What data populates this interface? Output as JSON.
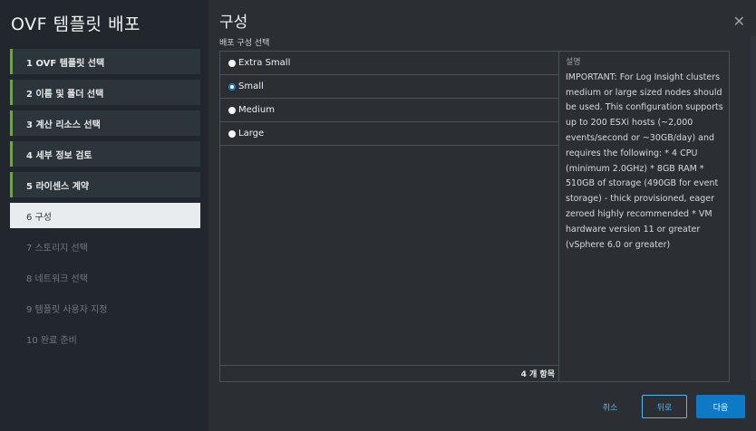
{
  "wizard": {
    "title": "OVF 템플릿 배포"
  },
  "steps": [
    {
      "label": "1 OVF 템플릿 선택",
      "state": "done"
    },
    {
      "label": "2 이름 및 폴더 선택",
      "state": "done"
    },
    {
      "label": "3 계산 리소스 선택",
      "state": "done"
    },
    {
      "label": "4 세부 정보 검토",
      "state": "done"
    },
    {
      "label": "5 라이센스 계약",
      "state": "done"
    },
    {
      "label": "6 구성",
      "state": "active"
    },
    {
      "label": "7 스토리지 선택",
      "state": "future"
    },
    {
      "label": "8 네트워크 선택",
      "state": "future"
    },
    {
      "label": "9 템플릿 사용자 지정",
      "state": "future"
    },
    {
      "label": "10 완료 준비",
      "state": "future"
    }
  ],
  "main": {
    "title": "구성",
    "subtitle": "배포 구성 선택",
    "close_icon": "close-icon"
  },
  "options": [
    {
      "label": "Extra Small",
      "selected": false
    },
    {
      "label": "Small",
      "selected": true
    },
    {
      "label": "Medium",
      "selected": false
    },
    {
      "label": "Large",
      "selected": false
    }
  ],
  "footer": {
    "count": "4 개 항목"
  },
  "description": {
    "title": "설명",
    "text": "IMPORTANT: For Log Insight clusters medium or large sized nodes should be used. This configuration supports up to 200 ESXi hosts (~2,000 events/second or ~30GB/day) and requires the following: * 4 CPU (minimum 2.0GHz) * 8GB RAM * 510GB of storage (490GB for event storage) - thick provisioned, eager zeroed highly recommended * VM hardware version 11 or greater (vSphere 6.0 or greater)"
  },
  "buttons": {
    "cancel": "취소",
    "back": "뒤로",
    "next": "다음"
  },
  "colors": {
    "accent": "#0d79c7",
    "done_marker": "#5eb715",
    "active_bg": "#e8ecee"
  }
}
